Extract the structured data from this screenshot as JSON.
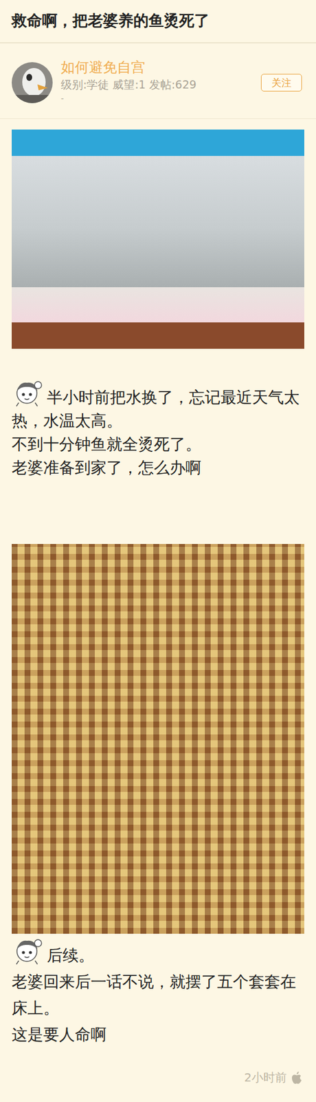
{
  "post": {
    "title": "救命啊，把老婆养的鱼烫死了"
  },
  "author": {
    "name": "如何避免自宫",
    "meta": "级别:学徒 威望:1 发帖:629",
    "note": "-",
    "follow_button": "关注"
  },
  "content": [
    {
      "kind": "photo"
    },
    {
      "kind": "text",
      "lines": [
        "半小时前把水换了，忘记最近天气太热，水温太高。",
        "不到十分钟鱼就全烫死了。",
        "老婆准备到家了，怎么办啊"
      ]
    },
    {
      "kind": "photo"
    },
    {
      "kind": "text",
      "lines": [
        "后续。",
        "老婆回来后一话不说，就摆了五个套套在床上。",
        "这是要人命啊"
      ]
    }
  ],
  "time": "2小时前"
}
